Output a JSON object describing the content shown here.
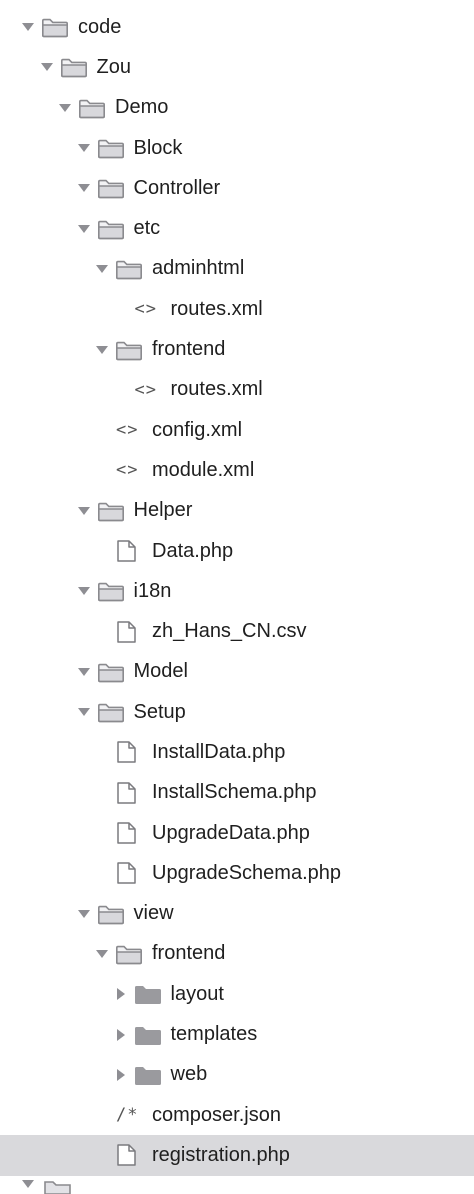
{
  "tree": [
    {
      "id": "code",
      "label": "code",
      "depth": 0,
      "kind": "folder",
      "disc": "open",
      "icon": "folder-outline-icon",
      "selected": false
    },
    {
      "id": "zou",
      "label": "Zou",
      "depth": 1,
      "kind": "folder",
      "disc": "open",
      "icon": "folder-outline-icon",
      "selected": false
    },
    {
      "id": "demo",
      "label": "Demo",
      "depth": 2,
      "kind": "folder",
      "disc": "open",
      "icon": "folder-outline-icon",
      "selected": false
    },
    {
      "id": "block",
      "label": "Block",
      "depth": 3,
      "kind": "folder",
      "disc": "open",
      "icon": "folder-outline-icon",
      "selected": false
    },
    {
      "id": "controller",
      "label": "Controller",
      "depth": 3,
      "kind": "folder",
      "disc": "open",
      "icon": "folder-outline-icon",
      "selected": false
    },
    {
      "id": "etc",
      "label": "etc",
      "depth": 3,
      "kind": "folder",
      "disc": "open",
      "icon": "folder-outline-icon",
      "selected": false
    },
    {
      "id": "adminhtml",
      "label": "adminhtml",
      "depth": 4,
      "kind": "folder",
      "disc": "open",
      "icon": "folder-outline-icon",
      "selected": false
    },
    {
      "id": "routes-xml-1",
      "label": "routes.xml",
      "depth": 5,
      "kind": "xml",
      "disc": "none",
      "icon": "code-file-icon",
      "selected": false
    },
    {
      "id": "frontend-etc",
      "label": "frontend",
      "depth": 4,
      "kind": "folder",
      "disc": "open",
      "icon": "folder-outline-icon",
      "selected": false
    },
    {
      "id": "routes-xml-2",
      "label": "routes.xml",
      "depth": 5,
      "kind": "xml",
      "disc": "none",
      "icon": "code-file-icon",
      "selected": false
    },
    {
      "id": "config-xml",
      "label": "config.xml",
      "depth": 4,
      "kind": "xml",
      "disc": "none",
      "icon": "code-file-icon",
      "selected": false
    },
    {
      "id": "module-xml",
      "label": "module.xml",
      "depth": 4,
      "kind": "xml",
      "disc": "none",
      "icon": "code-file-icon",
      "selected": false
    },
    {
      "id": "helper",
      "label": "Helper",
      "depth": 3,
      "kind": "folder",
      "disc": "open",
      "icon": "folder-outline-icon",
      "selected": false
    },
    {
      "id": "data-php",
      "label": "Data.php",
      "depth": 4,
      "kind": "file",
      "disc": "none",
      "icon": "file-icon",
      "selected": false
    },
    {
      "id": "i18n",
      "label": "i18n",
      "depth": 3,
      "kind": "folder",
      "disc": "open",
      "icon": "folder-outline-icon",
      "selected": false
    },
    {
      "id": "zh-hans-cn-csv",
      "label": "zh_Hans_CN.csv",
      "depth": 4,
      "kind": "file",
      "disc": "none",
      "icon": "file-icon",
      "selected": false
    },
    {
      "id": "model",
      "label": "Model",
      "depth": 3,
      "kind": "folder",
      "disc": "open",
      "icon": "folder-outline-icon",
      "selected": false
    },
    {
      "id": "setup",
      "label": "Setup",
      "depth": 3,
      "kind": "folder",
      "disc": "open",
      "icon": "folder-outline-icon",
      "selected": false
    },
    {
      "id": "installdata-php",
      "label": "InstallData.php",
      "depth": 4,
      "kind": "file",
      "disc": "none",
      "icon": "file-icon",
      "selected": false
    },
    {
      "id": "installschema-php",
      "label": "InstallSchema.php",
      "depth": 4,
      "kind": "file",
      "disc": "none",
      "icon": "file-icon",
      "selected": false
    },
    {
      "id": "upgradedata-php",
      "label": "UpgradeData.php",
      "depth": 4,
      "kind": "file",
      "disc": "none",
      "icon": "file-icon",
      "selected": false
    },
    {
      "id": "upgradeschema-php",
      "label": "UpgradeSchema.php",
      "depth": 4,
      "kind": "file",
      "disc": "none",
      "icon": "file-icon",
      "selected": false
    },
    {
      "id": "view",
      "label": "view",
      "depth": 3,
      "kind": "folder",
      "disc": "open",
      "icon": "folder-outline-icon",
      "selected": false
    },
    {
      "id": "frontend-view",
      "label": "frontend",
      "depth": 4,
      "kind": "folder",
      "disc": "open",
      "icon": "folder-outline-icon",
      "selected": false
    },
    {
      "id": "layout",
      "label": "layout",
      "depth": 5,
      "kind": "folder",
      "disc": "closed",
      "icon": "folder-filled-icon",
      "selected": false
    },
    {
      "id": "templates",
      "label": "templates",
      "depth": 5,
      "kind": "folder",
      "disc": "closed",
      "icon": "folder-filled-icon",
      "selected": false
    },
    {
      "id": "web",
      "label": "web",
      "depth": 5,
      "kind": "folder",
      "disc": "closed",
      "icon": "folder-filled-icon",
      "selected": false
    },
    {
      "id": "composer-json",
      "label": "composer.json",
      "depth": 4,
      "kind": "json",
      "disc": "none",
      "icon": "json-file-icon",
      "selected": false
    },
    {
      "id": "registration-php",
      "label": "registration.php",
      "depth": 4,
      "kind": "file",
      "disc": "none",
      "icon": "file-icon",
      "selected": true
    }
  ],
  "code_glyph": "<>",
  "json_glyph": "/*",
  "colors": {
    "folder_stroke": "#8a8a8e",
    "folder_fill": "#d8d8dc",
    "folder_closed_fill": "#9a9a9e",
    "disclosure": "#8e8e93",
    "text": "#1f1f1f",
    "selection": "#d9d9dc"
  }
}
